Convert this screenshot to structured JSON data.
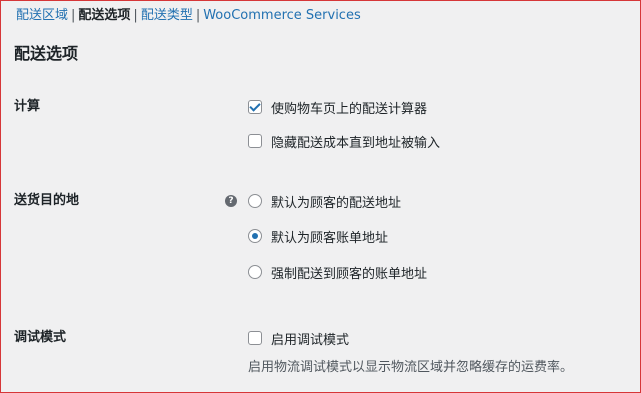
{
  "subnav": {
    "items": [
      {
        "label": "配送区域",
        "current": false
      },
      {
        "label": "配送选项",
        "current": true
      },
      {
        "label": "配送类型",
        "current": false
      },
      {
        "label": "WooCommerce Services",
        "current": false
      }
    ],
    "separator": "|"
  },
  "page_title": "配送选项",
  "calc": {
    "label": "计算",
    "options": [
      {
        "label": "使购物车页上的配送计算器",
        "checked": true
      },
      {
        "label": "隐藏配送成本直到地址被输入",
        "checked": false
      }
    ]
  },
  "destination": {
    "label": "送货目的地",
    "help_icon": "help-icon",
    "help_glyph": "?",
    "options": [
      {
        "label": "默认为顾客的配送地址",
        "selected": false
      },
      {
        "label": "默认为顾客账单地址",
        "selected": true
      },
      {
        "label": "强制配送到顾客的账单地址",
        "selected": false
      }
    ]
  },
  "debug": {
    "label": "调试模式",
    "option": {
      "label": "启用调试模式",
      "checked": false
    },
    "description": "启用物流调试模式以显示物流区域并忽略缓存的运费率。"
  },
  "colors": {
    "link": "#2271b1",
    "accent": "#2271b1",
    "background": "#f0f0f1",
    "frame_border": "#d63638"
  }
}
